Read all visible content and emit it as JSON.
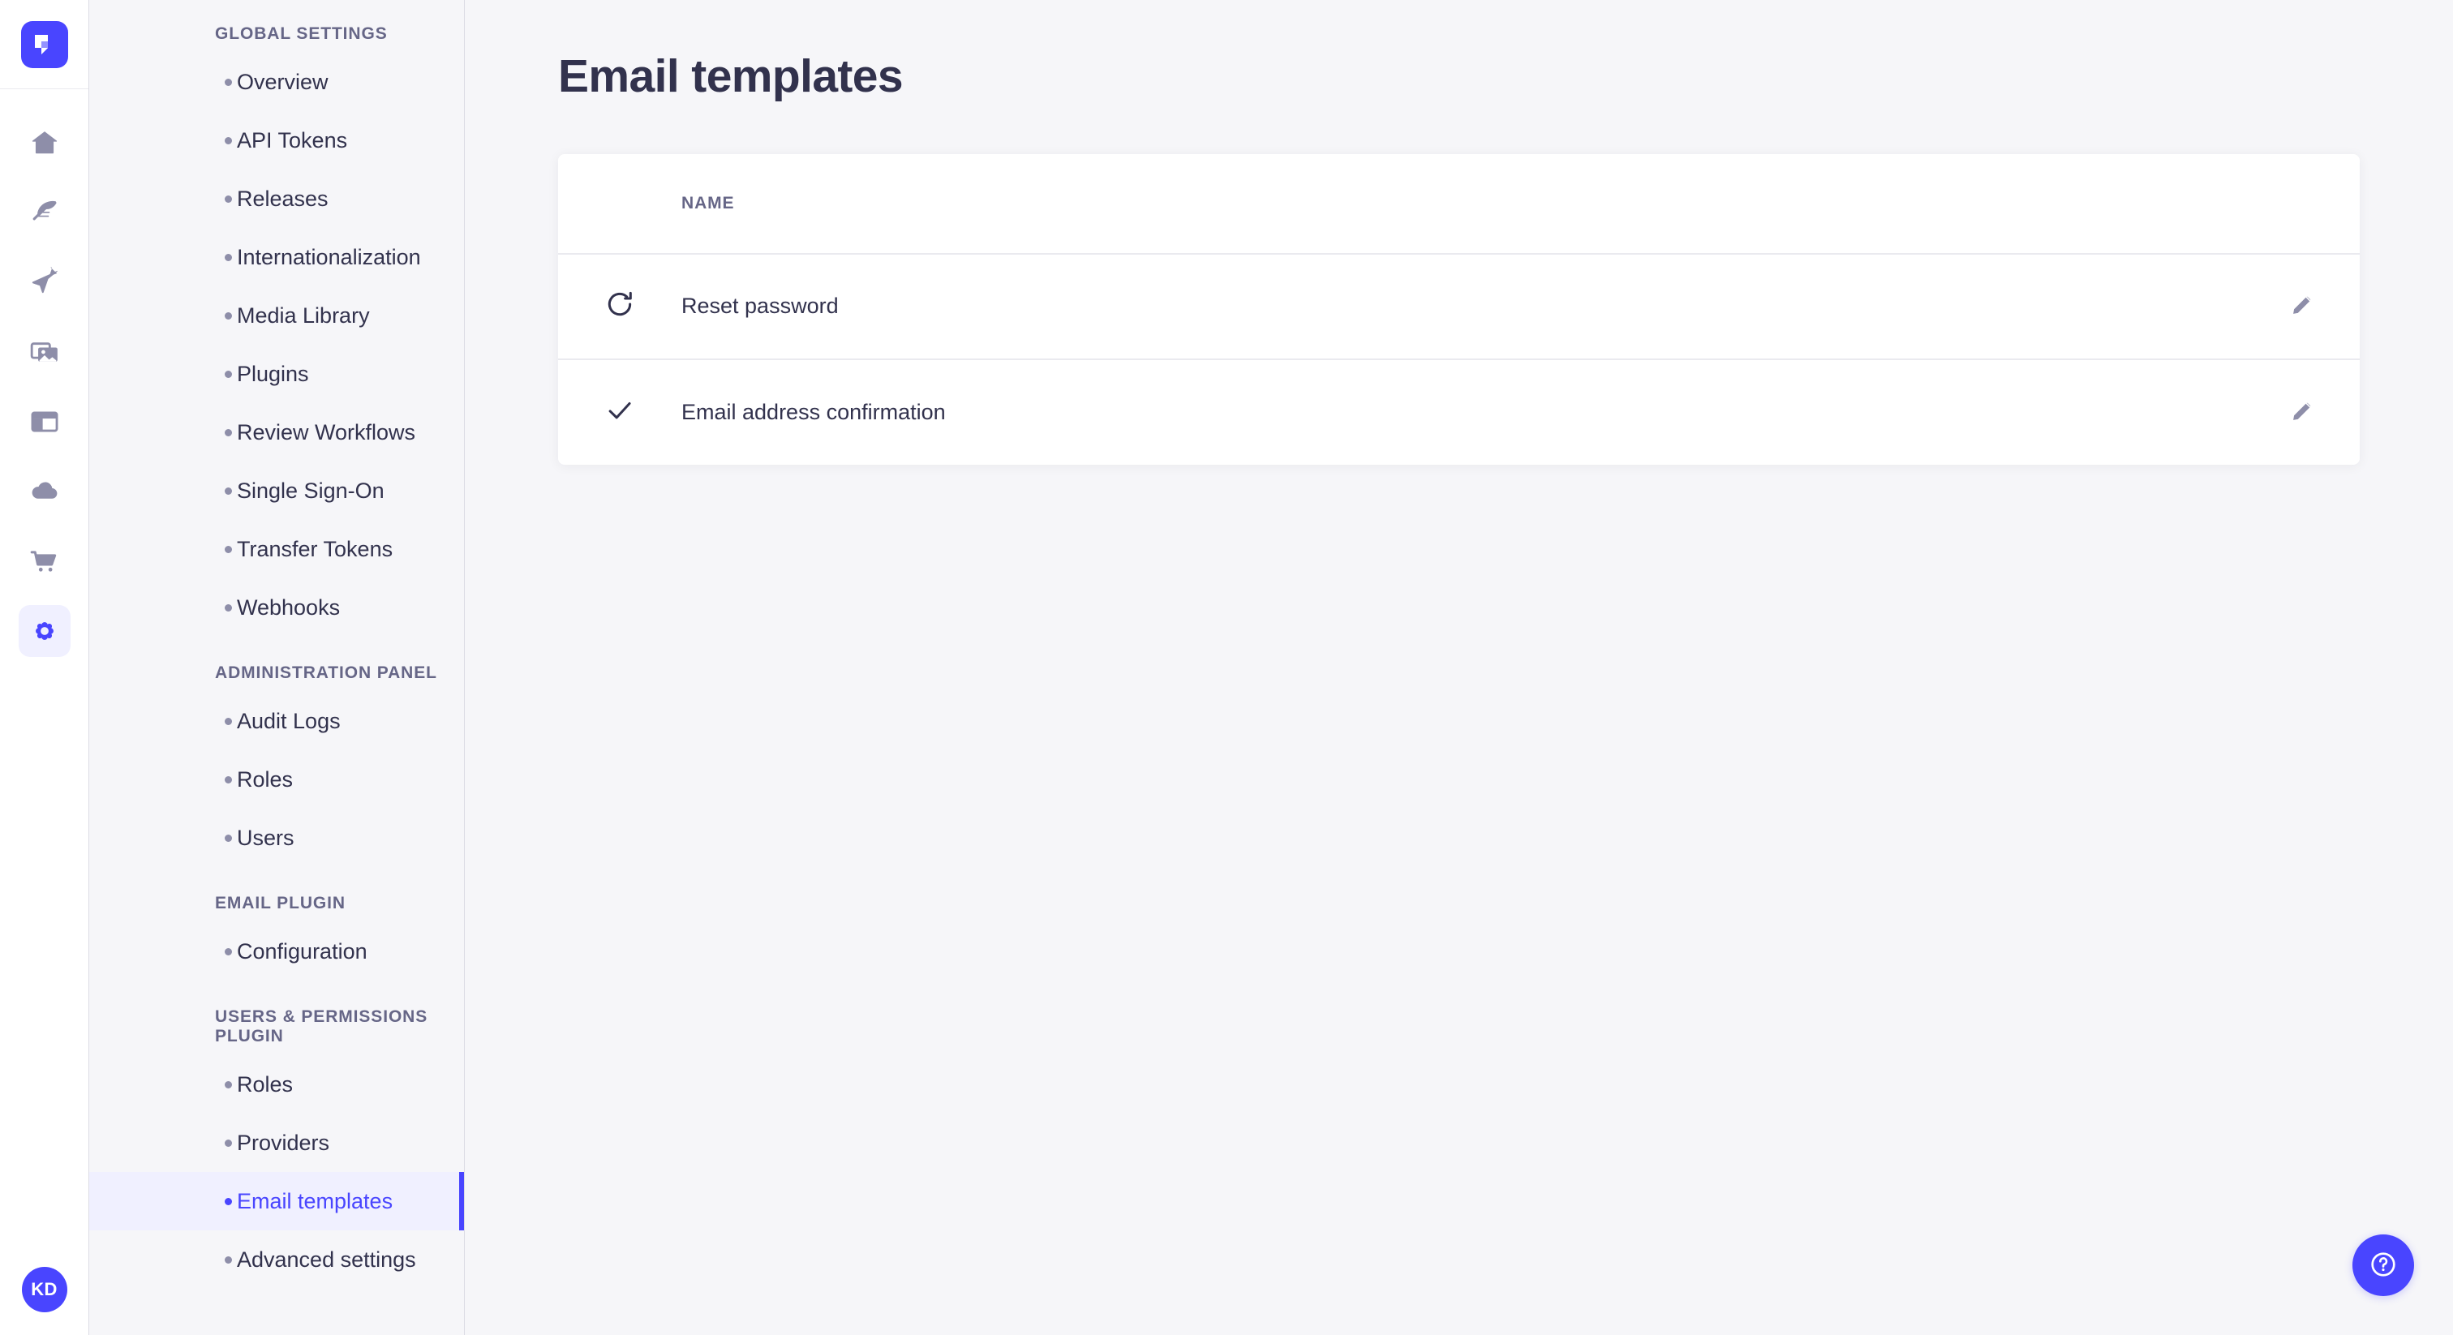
{
  "brand": {
    "logo_icon": "strapi-logo-icon",
    "accent_color": "#4945ff",
    "active_bg_color": "#f0f0ff",
    "page_bg_color": "#f6f6f9",
    "text_color": "#32324d",
    "muted_text_color": "#666687"
  },
  "rail": {
    "items": [
      {
        "icon": "home-icon",
        "name": "home"
      },
      {
        "icon": "feather-icon",
        "name": "content-manager"
      },
      {
        "icon": "paper-plane-icon",
        "name": "content-type-builder"
      },
      {
        "icon": "images-icon",
        "name": "media-library"
      },
      {
        "icon": "layout-icon",
        "name": "single-types"
      },
      {
        "icon": "cloud-icon",
        "name": "cloud"
      },
      {
        "icon": "shopping-cart-icon",
        "name": "marketplace"
      },
      {
        "icon": "gear-icon",
        "name": "settings",
        "active": true
      }
    ],
    "avatar_initials": "KD"
  },
  "sidebar": {
    "sections": [
      {
        "title": "GLOBAL SETTINGS",
        "items": [
          {
            "label": "Overview"
          },
          {
            "label": "API Tokens"
          },
          {
            "label": "Releases"
          },
          {
            "label": "Internationalization"
          },
          {
            "label": "Media Library"
          },
          {
            "label": "Plugins"
          },
          {
            "label": "Review Workflows"
          },
          {
            "label": "Single Sign-On"
          },
          {
            "label": "Transfer Tokens"
          },
          {
            "label": "Webhooks"
          }
        ]
      },
      {
        "title": "ADMINISTRATION PANEL",
        "items": [
          {
            "label": "Audit Logs"
          },
          {
            "label": "Roles"
          },
          {
            "label": "Users"
          }
        ]
      },
      {
        "title": "EMAIL PLUGIN",
        "items": [
          {
            "label": "Configuration"
          }
        ]
      },
      {
        "title": "USERS & PERMISSIONS PLUGIN",
        "items": [
          {
            "label": "Roles"
          },
          {
            "label": "Providers"
          },
          {
            "label": "Email templates",
            "active": true
          },
          {
            "label": "Advanced settings"
          }
        ]
      }
    ]
  },
  "main": {
    "page_title": "Email templates",
    "table": {
      "columns": [
        "NAME"
      ],
      "rows": [
        {
          "icon": "refresh-icon",
          "name": "Reset password",
          "action_icon": "pencil-icon"
        },
        {
          "icon": "check-icon",
          "name": "Email address confirmation",
          "action_icon": "pencil-icon"
        }
      ]
    },
    "help_button": {
      "icon": "question-mark-circle-icon",
      "label": "Help"
    }
  }
}
